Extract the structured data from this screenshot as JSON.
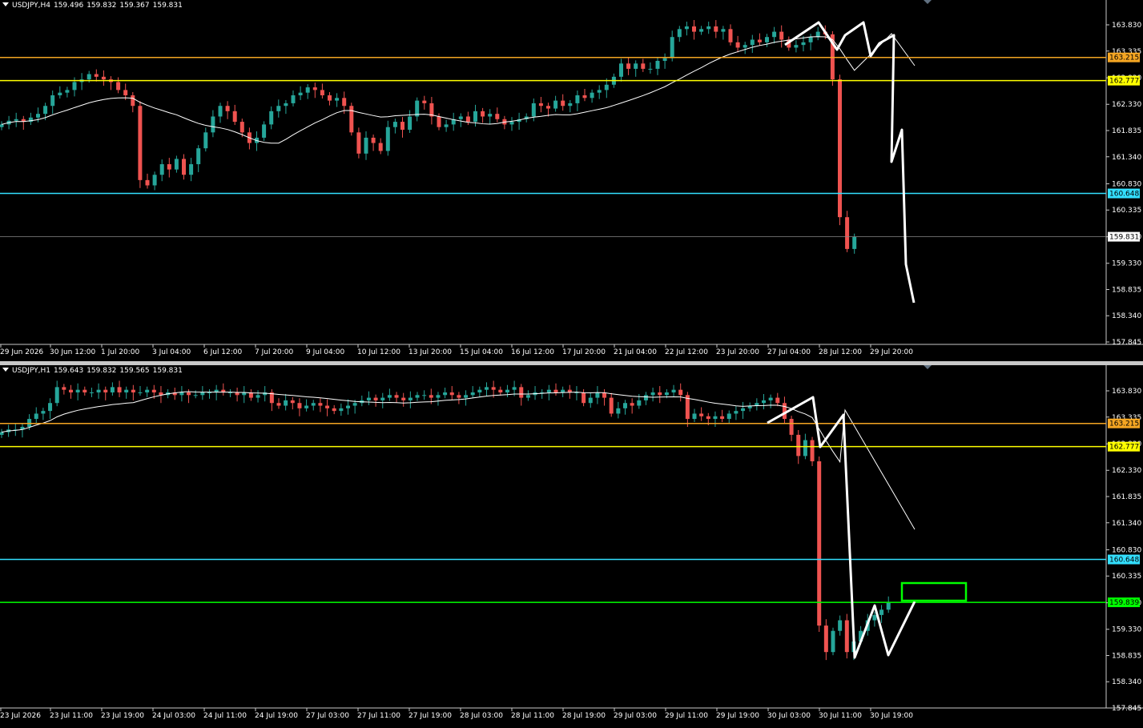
{
  "panels": [
    {
      "id": "h4",
      "title": {
        "symbol_tf": "USDJPY,H4",
        "open": "159.496",
        "high": "159.832",
        "low": "159.367",
        "close": "159.831"
      },
      "price_axis": {
        "ticks": [
          "163.830",
          "163.335",
          "162.830",
          "162.330",
          "161.835",
          "161.340",
          "160.830",
          "160.335",
          "159.830",
          "159.330",
          "158.835",
          "158.340",
          "157.845"
        ]
      },
      "time_axis": {
        "labels": [
          "29 Jun 2026",
          "30 Jun 12:00",
          "1 Jul 20:00",
          "3 Jul 04:00",
          "6 Jul 12:00",
          "7 Jul 20:00",
          "9 Jul 04:00",
          "10 Jul 12:00",
          "13 Jul 20:00",
          "15 Jul 04:00",
          "16 Jul 12:00",
          "17 Jul 20:00",
          "21 Jul 04:00",
          "22 Jul 12:00",
          "23 Jul 20:00",
          "27 Jul 04:00",
          "28 Jul 12:00",
          "29 Jul 20:00"
        ]
      },
      "levels": [
        {
          "label": "163.215",
          "color": "#f5a623",
          "label_bg": "#f5a623",
          "label_fg": "#000000"
        },
        {
          "label": "162.777",
          "color": "#ffff00",
          "label_bg": "#ffff00",
          "label_fg": "#000000"
        },
        {
          "label": "160.648",
          "color": "#33dfff",
          "label_bg": "#33dfff",
          "label_fg": "#000000"
        },
        {
          "label": "159.831",
          "color": "#888888",
          "label_bg": "#ffffff",
          "label_fg": "#000000"
        }
      ]
    },
    {
      "id": "h1",
      "title": {
        "symbol_tf": "USDJPY,H1",
        "open": "159.643",
        "high": "159.832",
        "low": "159.565",
        "close": "159.831"
      },
      "price_axis": {
        "ticks": [
          "163.830",
          "163.335",
          "162.830",
          "162.330",
          "161.835",
          "161.340",
          "160.830",
          "160.335",
          "159.830",
          "159.330",
          "158.835",
          "158.340",
          "157.845"
        ]
      },
      "time_axis": {
        "labels": [
          "23 Jul 2026",
          "23 Jul 11:00",
          "23 Jul 19:00",
          "24 Jul 03:00",
          "24 Jul 11:00",
          "24 Jul 19:00",
          "27 Jul 03:00",
          "27 Jul 11:00",
          "27 Jul 19:00",
          "28 Jul 03:00",
          "28 Jul 11:00",
          "28 Jul 19:00",
          "29 Jul 03:00",
          "29 Jul 11:00",
          "29 Jul 19:00",
          "30 Jul 03:00",
          "30 Jul 11:00",
          "30 Jul 19:00"
        ]
      },
      "levels": [
        {
          "label": "163.215",
          "color": "#f5a623",
          "label_bg": "#f5a623",
          "label_fg": "#000000"
        },
        {
          "label": "162.777",
          "color": "#ffff00",
          "label_bg": "#ffff00",
          "label_fg": "#000000"
        },
        {
          "label": "160.648",
          "color": "#33dfff",
          "label_bg": "#33dfff",
          "label_fg": "#000000"
        },
        {
          "label": "159.839",
          "color": "#00ff00",
          "label_bg": "#00ff00",
          "label_fg": "#000000"
        }
      ]
    }
  ],
  "chart_data": [
    {
      "type": "candlestick",
      "title": "USDJPY,H4",
      "ylim": [
        157.845,
        164.1
      ],
      "candle_colors": {
        "up": "#26a69a",
        "down": "#ef5350"
      },
      "grid": false,
      "horizontal_levels": [
        163.215,
        162.777,
        160.648,
        159.831
      ],
      "moving_average": "white thin line",
      "closes": [
        161.95,
        162.02,
        162.05,
        162.0,
        162.08,
        162.15,
        162.3,
        162.5,
        162.55,
        162.6,
        162.75,
        162.8,
        162.9,
        162.85,
        162.8,
        162.75,
        162.6,
        162.5,
        162.3,
        160.9,
        160.8,
        161.0,
        161.2,
        161.1,
        161.3,
        161.0,
        161.2,
        161.5,
        161.8,
        162.1,
        162.3,
        162.2,
        162.0,
        161.8,
        161.6,
        161.7,
        161.95,
        162.2,
        162.3,
        162.35,
        162.5,
        162.55,
        162.65,
        162.6,
        162.5,
        162.4,
        162.45,
        162.3,
        161.8,
        161.4,
        161.7,
        161.6,
        161.45,
        161.9,
        162.0,
        161.85,
        162.1,
        162.4,
        162.35,
        162.1,
        161.9,
        161.95,
        162.05,
        162.1,
        162.0,
        162.2,
        162.1,
        162.15,
        162.05,
        161.95,
        162.0,
        162.05,
        162.1,
        162.35,
        162.3,
        162.25,
        162.4,
        162.3,
        162.35,
        162.5,
        162.45,
        162.55,
        162.6,
        162.7,
        162.85,
        163.1,
        163.0,
        163.1,
        163.0,
        163.0,
        163.15,
        163.2,
        163.6,
        163.75,
        163.8,
        163.7,
        163.75,
        163.8,
        163.7,
        163.75,
        163.5,
        163.4,
        163.45,
        163.55,
        163.5,
        163.6,
        163.7,
        163.55,
        163.4,
        163.45,
        163.5,
        163.6,
        163.7,
        163.65,
        162.8,
        160.2,
        159.6,
        159.83
      ]
    },
    {
      "type": "candlestick",
      "title": "USDJPY,H1",
      "ylim": [
        157.845,
        164.1
      ],
      "candle_colors": {
        "up": "#26a69a",
        "down": "#ef5350"
      },
      "grid": false,
      "horizontal_levels": [
        163.215,
        162.777,
        160.648,
        159.839
      ],
      "moving_average": "white thin line",
      "closes": [
        163.05,
        163.1,
        163.1,
        163.15,
        163.3,
        163.4,
        163.45,
        163.6,
        163.9,
        163.85,
        163.8,
        163.85,
        163.8,
        163.8,
        163.85,
        163.8,
        163.9,
        163.8,
        163.85,
        163.8,
        163.8,
        163.85,
        163.8,
        163.75,
        163.8,
        163.75,
        163.8,
        163.75,
        163.75,
        163.8,
        163.8,
        163.85,
        163.8,
        163.8,
        163.75,
        163.8,
        163.7,
        163.75,
        163.8,
        163.6,
        163.55,
        163.65,
        163.6,
        163.5,
        163.55,
        163.6,
        163.55,
        163.5,
        163.45,
        163.5,
        163.55,
        163.6,
        163.65,
        163.7,
        163.65,
        163.7,
        163.75,
        163.7,
        163.65,
        163.7,
        163.75,
        163.75,
        163.7,
        163.75,
        163.8,
        163.75,
        163.7,
        163.75,
        163.8,
        163.85,
        163.9,
        163.85,
        163.8,
        163.85,
        163.9,
        163.7,
        163.75,
        163.8,
        163.8,
        163.85,
        163.8,
        163.85,
        163.8,
        163.8,
        163.6,
        163.7,
        163.8,
        163.7,
        163.4,
        163.5,
        163.6,
        163.55,
        163.65,
        163.75,
        163.8,
        163.75,
        163.8,
        163.85,
        163.75,
        163.3,
        163.4,
        163.35,
        163.3,
        163.35,
        163.3,
        163.4,
        163.45,
        163.5,
        163.55,
        163.6,
        163.65,
        163.7,
        163.6,
        163.3,
        163.0,
        162.6,
        162.9,
        162.5,
        159.4,
        158.9,
        159.3,
        159.5,
        158.9,
        159.1,
        159.3,
        159.5,
        159.6,
        159.7,
        159.83
      ]
    }
  ]
}
